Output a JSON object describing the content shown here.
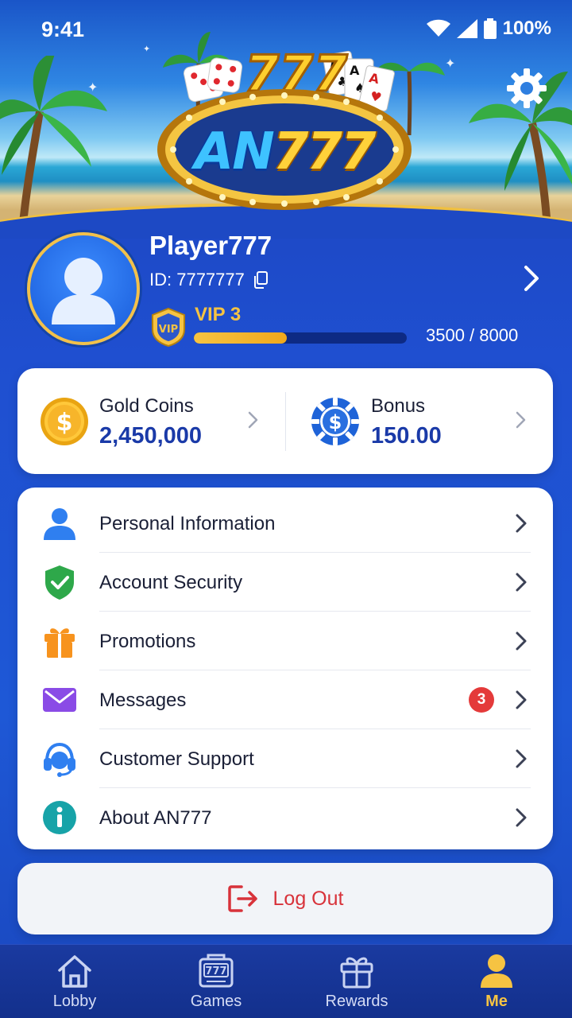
{
  "status_bar": {
    "time": "9:41",
    "battery": "100%"
  },
  "brand": {
    "logo_prefix": "AN",
    "logo_suffix": "777"
  },
  "profile": {
    "name": "Player777",
    "id_label": "ID: 7777777",
    "vip_label": "VIP 3",
    "vip_progress_text": "3500 / 8000",
    "vip_progress_fraction": 0.4375,
    "vip_badge_text": "VIP"
  },
  "wallet": {
    "gold": {
      "title": "Gold Coins",
      "value": "2,450,000"
    },
    "bonus": {
      "title": "Bonus",
      "value": "150.00"
    }
  },
  "menu": {
    "items": [
      {
        "label": "Personal Information",
        "icon": "person-icon"
      },
      {
        "label": "Account Security",
        "icon": "shield-check-icon"
      },
      {
        "label": "Promotions",
        "icon": "gift-icon"
      },
      {
        "label": "Messages",
        "icon": "mail-icon",
        "badge": "3"
      },
      {
        "label": "Customer Support",
        "icon": "headset-icon"
      },
      {
        "label": "About AN777",
        "icon": "info-icon"
      }
    ]
  },
  "logout": {
    "label": "Log Out"
  },
  "nav": {
    "items": [
      {
        "label": "Lobby",
        "icon": "home-icon"
      },
      {
        "label": "Games",
        "icon": "slot-machine-icon"
      },
      {
        "label": "Rewards",
        "icon": "gift-icon"
      },
      {
        "label": "Me",
        "icon": "user-icon",
        "active": true
      }
    ]
  },
  "colors": {
    "accent_gold": "#f6c342",
    "primary_blue": "#1d49c4",
    "danger": "#d8323a"
  }
}
